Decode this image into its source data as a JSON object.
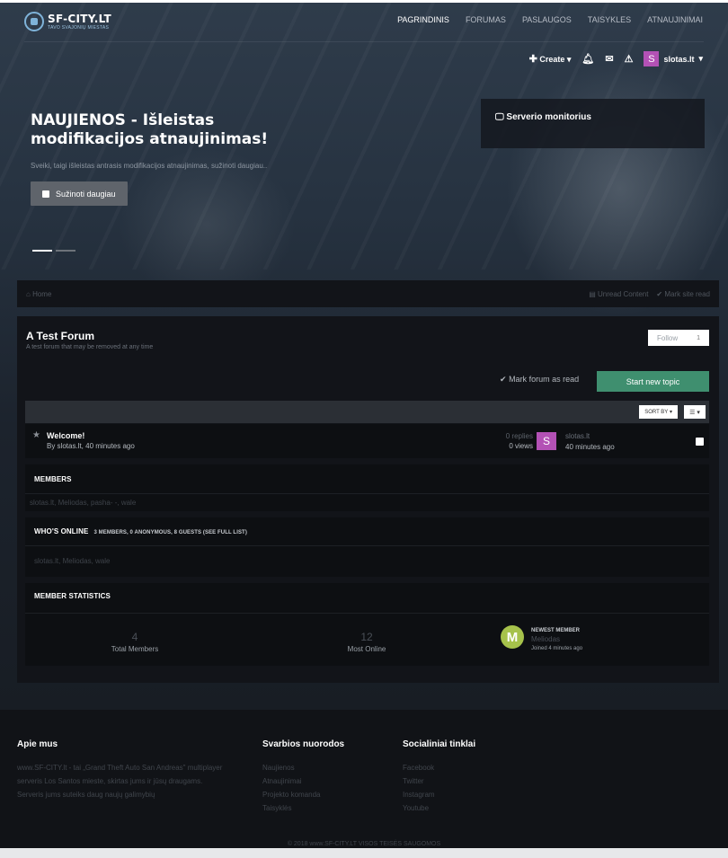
{
  "logo": {
    "title": "SF-CITY.LT",
    "subtitle": "TAVO SVAJONIŲ MIESTAS"
  },
  "nav": [
    "PAGRINDINIS",
    "FORUMAS",
    "PASLAUGOS",
    "TAISYKLES",
    "ATNAUJINIMAI"
  ],
  "userbar": {
    "create": "Create",
    "username": "slotas.lt",
    "avatar_letter": "S"
  },
  "hero": {
    "title": "NAUJIENOS - Išleistas modifikacijos atnaujinimas!",
    "subtitle": "Sveiki, taigi išleistas antrasis modifikacijos atnaujinimas, sužinoti daugiau..",
    "button": "Sužinoti daugiau"
  },
  "monitor": {
    "title": "Serverio monitorius"
  },
  "breadcrumb": {
    "home": "Home",
    "unread": "Unread Content",
    "mark_site": "Mark site read"
  },
  "forum": {
    "title": "A Test Forum",
    "description": "A test forum that may be removed at any time",
    "follow": "Follow",
    "follow_count": "1",
    "mark_read": "Mark forum as read",
    "start_topic": "Start new topic",
    "sort_by": "SORT BY"
  },
  "topic": {
    "title": "Welcome!",
    "by": "By slotas.lt, 40 minutes ago",
    "replies": "0 replies",
    "views": "0 views",
    "avatar_letter": "S",
    "last_user": "slotas.lt",
    "last_time": "40 minutes ago"
  },
  "members": {
    "title": "MEMBERS",
    "list": "slotas.lt, Meliodas, pasha- -, wale"
  },
  "online": {
    "title": "WHO'S ONLINE",
    "counts": "3 MEMBERS, 0 ANONYMOUS, 8 GUESTS (SEE FULL LIST)",
    "list": "slotas.lt, Meliodas, wale"
  },
  "statistics": {
    "title": "MEMBER STATISTICS",
    "total_value": "4",
    "total_label": "Total Members",
    "online_value": "12",
    "online_label": "Most Online",
    "newest_label": "NEWEST MEMBER",
    "newest_user": "Meliodas",
    "newest_joined": "Joined 4 minutes ago",
    "newest_letter": "M"
  },
  "footer": {
    "about_title": "Apie mus",
    "about_lines": [
      "www.SF-CITY.lt - tai „Grand Theft Auto San Andreas\" multiplayer",
      "serveris Los Santos mieste, skirtas jums ir jūsų draugams.",
      "Serveris jums suteiks daug naujų galimybių"
    ],
    "links_title": "Svarbios nuorodos",
    "links": [
      "Naujienos",
      "Atnaujinimai",
      "Projekto komanda",
      "Taisyklės"
    ],
    "social_title": "Socialiniai tinklai",
    "social": [
      "Facebook",
      "Twitter",
      "Instagram",
      "Youtube"
    ],
    "copyright": "© 2018 www.SF-CITY.LT VISOS TEISĖS SAUGOMOS"
  },
  "colors": {
    "accent": "#3f8f6f",
    "avatar": "#b351b5",
    "newest_avatar": "#a6c24b",
    "background": "#15171c"
  },
  "icons": [
    "plus-icon",
    "caret-down-icon",
    "bell-icon",
    "envelope-icon",
    "warning-icon",
    "monitor-icon",
    "home-icon",
    "check-icon",
    "star-icon",
    "list-icon"
  ]
}
